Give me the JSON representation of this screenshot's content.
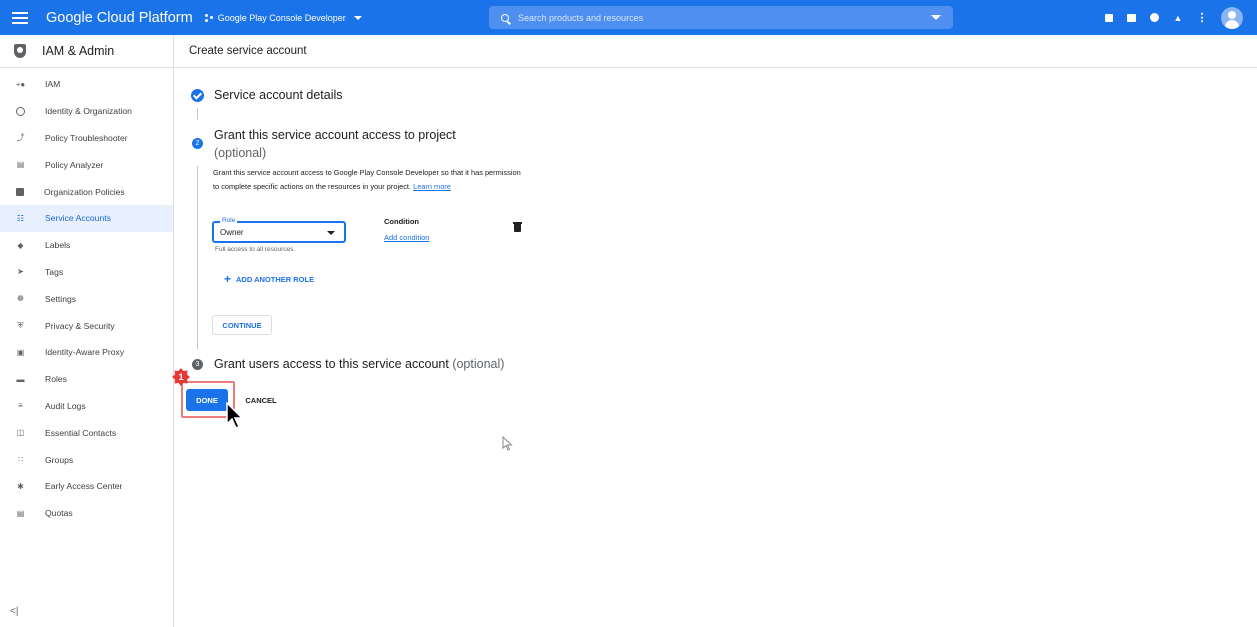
{
  "topbar": {
    "brand": "Google Cloud Platform",
    "project": "Google Play Console Developer",
    "search_placeholder": "Search products and resources"
  },
  "sidebar": {
    "title": "IAM & Admin",
    "items": [
      {
        "label": "IAM",
        "icon": "person-add-icon"
      },
      {
        "label": "Identity & Organization",
        "icon": "account-circle-icon"
      },
      {
        "label": "Policy Troubleshooter",
        "icon": "wrench-icon"
      },
      {
        "label": "Policy Analyzer",
        "icon": "document-search-icon"
      },
      {
        "label": "Organization Policies",
        "icon": "list-box-icon"
      },
      {
        "label": "Service Accounts",
        "icon": "service-account-icon",
        "active": true
      },
      {
        "label": "Labels",
        "icon": "label-icon"
      },
      {
        "label": "Tags",
        "icon": "tag-icon"
      },
      {
        "label": "Settings",
        "icon": "gear-icon"
      },
      {
        "label": "Privacy & Security",
        "icon": "shield-icon"
      },
      {
        "label": "Identity-Aware Proxy",
        "icon": "proxy-icon"
      },
      {
        "label": "Roles",
        "icon": "roles-icon"
      },
      {
        "label": "Audit Logs",
        "icon": "list-icon"
      },
      {
        "label": "Essential Contacts",
        "icon": "contact-card-icon"
      },
      {
        "label": "Groups",
        "icon": "groups-icon"
      },
      {
        "label": "Early Access Center",
        "icon": "early-access-icon"
      },
      {
        "label": "Quotas",
        "icon": "quota-icon"
      }
    ],
    "collapse_label": "<|"
  },
  "main": {
    "page_title": "Create service account",
    "step1": {
      "title": "Service account details"
    },
    "step2": {
      "number": "2",
      "title": "Grant this service account access to project",
      "optional": "(optional)",
      "description": "Grant this service account access to Google Play Console Developer so that it has permission to complete specific actions on the resources in your project.",
      "learn_more": "Learn more",
      "role_label": "Role",
      "role_value": "Owner",
      "role_help": "Full access to all resources.",
      "condition_label": "Condition",
      "add_condition": "Add condition",
      "add_another_role": "ADD ANOTHER ROLE",
      "continue": "CONTINUE"
    },
    "step3": {
      "number": "3",
      "title": "Grant users access to this service account",
      "optional": "(optional)"
    },
    "done": "DONE",
    "cancel": "CANCEL",
    "annotation_marker": "1"
  },
  "colors": {
    "brand_blue": "#1a73e8",
    "highlight": "#ee7a7a",
    "marker_red": "#e53935"
  }
}
